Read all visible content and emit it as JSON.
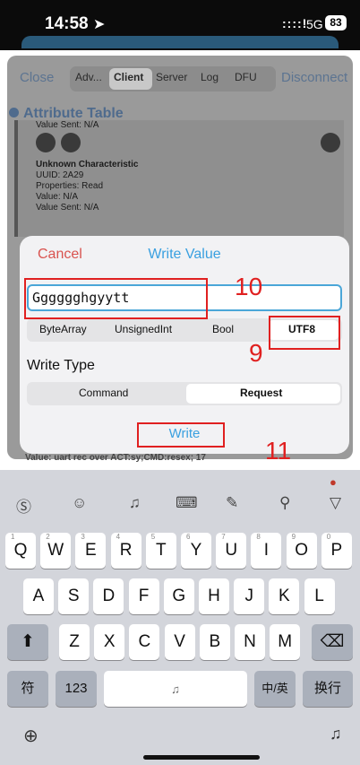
{
  "status": {
    "time": "14:58",
    "signal": "::::!",
    "network": "5G",
    "battery": "83"
  },
  "nav": {
    "close": "Close",
    "disconnect": "Disconnect",
    "tabs": [
      "Adv...",
      "Client",
      "Server",
      "Log",
      "DFU"
    ]
  },
  "attr_title": "Attribute Table",
  "card": {
    "value_sent_top": "Value Sent: N/A",
    "name": "Unknown Characteristic",
    "uuid": "UUID: 2A29",
    "properties": "Properties: Read",
    "value": "Value: N/A",
    "value_sent": "Value Sent: N/A"
  },
  "dialog": {
    "cancel": "Cancel",
    "title": "Write Value",
    "input_value": "Gggggghgyytt",
    "encodings": [
      "ByteArray",
      "UnsignedInt",
      "Bool",
      "UTF8"
    ],
    "write_type_label": "Write Type",
    "write_types": [
      "Command",
      "Request"
    ],
    "write": "Write"
  },
  "behind_value": "Value: uart rec over  ACT:sy;CMD:resex; 17",
  "annotations": {
    "a10": "10",
    "a9": "9",
    "a11": "11"
  },
  "keyboard": {
    "row1": [
      "Q",
      "W",
      "E",
      "R",
      "T",
      "Y",
      "U",
      "I",
      "O",
      "P"
    ],
    "row1_hints": [
      "1",
      "2",
      "3",
      "4",
      "5",
      "6",
      "7",
      "8",
      "9",
      "0"
    ],
    "row2": [
      "A",
      "S",
      "D",
      "F",
      "G",
      "H",
      "J",
      "K",
      "L"
    ],
    "row3": [
      "Z",
      "X",
      "C",
      "V",
      "B",
      "N",
      "M"
    ],
    "k_symbol": "符",
    "k_numbers": "123",
    "k_chinese": "中/英",
    "k_newline": "换行"
  },
  "colors": {
    "accent": "#3aa0e0",
    "cancel": "#d9534f",
    "annotation": "#e02020"
  }
}
